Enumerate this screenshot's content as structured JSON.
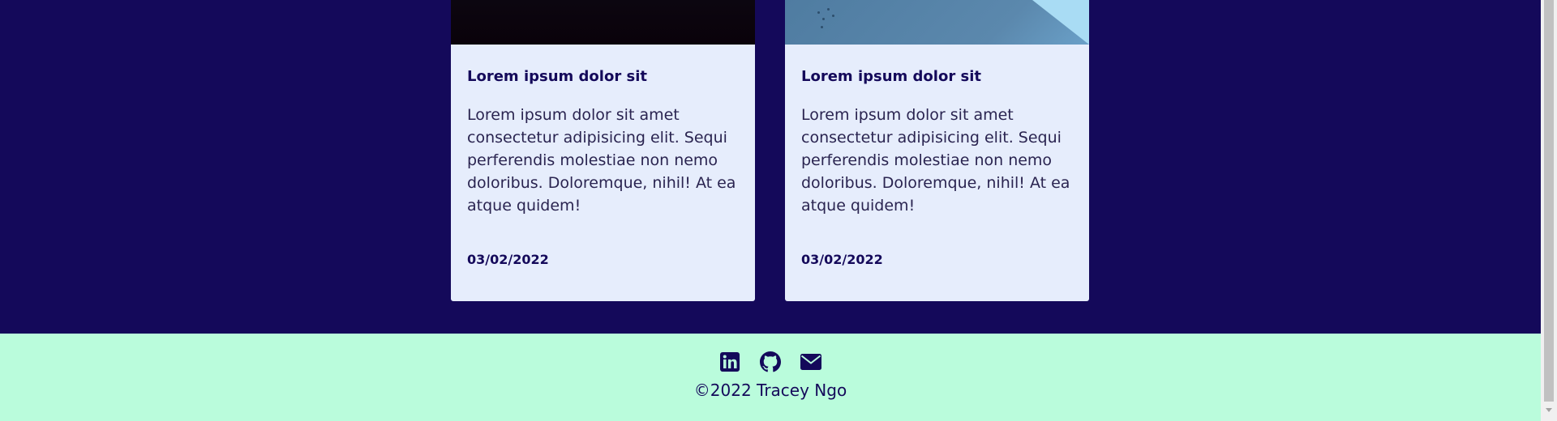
{
  "cards": [
    {
      "title": "Lorem ipsum dolor sit",
      "body": "Lorem ipsum dolor sit amet consectetur adipisicing elit. Sequi perferendis molestiae non nemo doloribus. Doloremque, nihil! At ea atque quidem!",
      "date": "03/02/2022"
    },
    {
      "title": "Lorem ipsum dolor sit",
      "body": "Lorem ipsum dolor sit amet consectetur adipisicing elit. Sequi perferendis molestiae non nemo doloribus. Doloremque, nihil! At ea atque quidem!",
      "date": "03/02/2022"
    }
  ],
  "footer": {
    "social_icons": [
      "linkedin-icon",
      "github-icon",
      "envelope-icon"
    ],
    "copyright": "©2022 Tracey Ngo"
  },
  "colors": {
    "main_background": "#14095a",
    "card_background": "#e6edfc",
    "footer_background": "#bafcdc",
    "text_dark": "#14095a"
  }
}
